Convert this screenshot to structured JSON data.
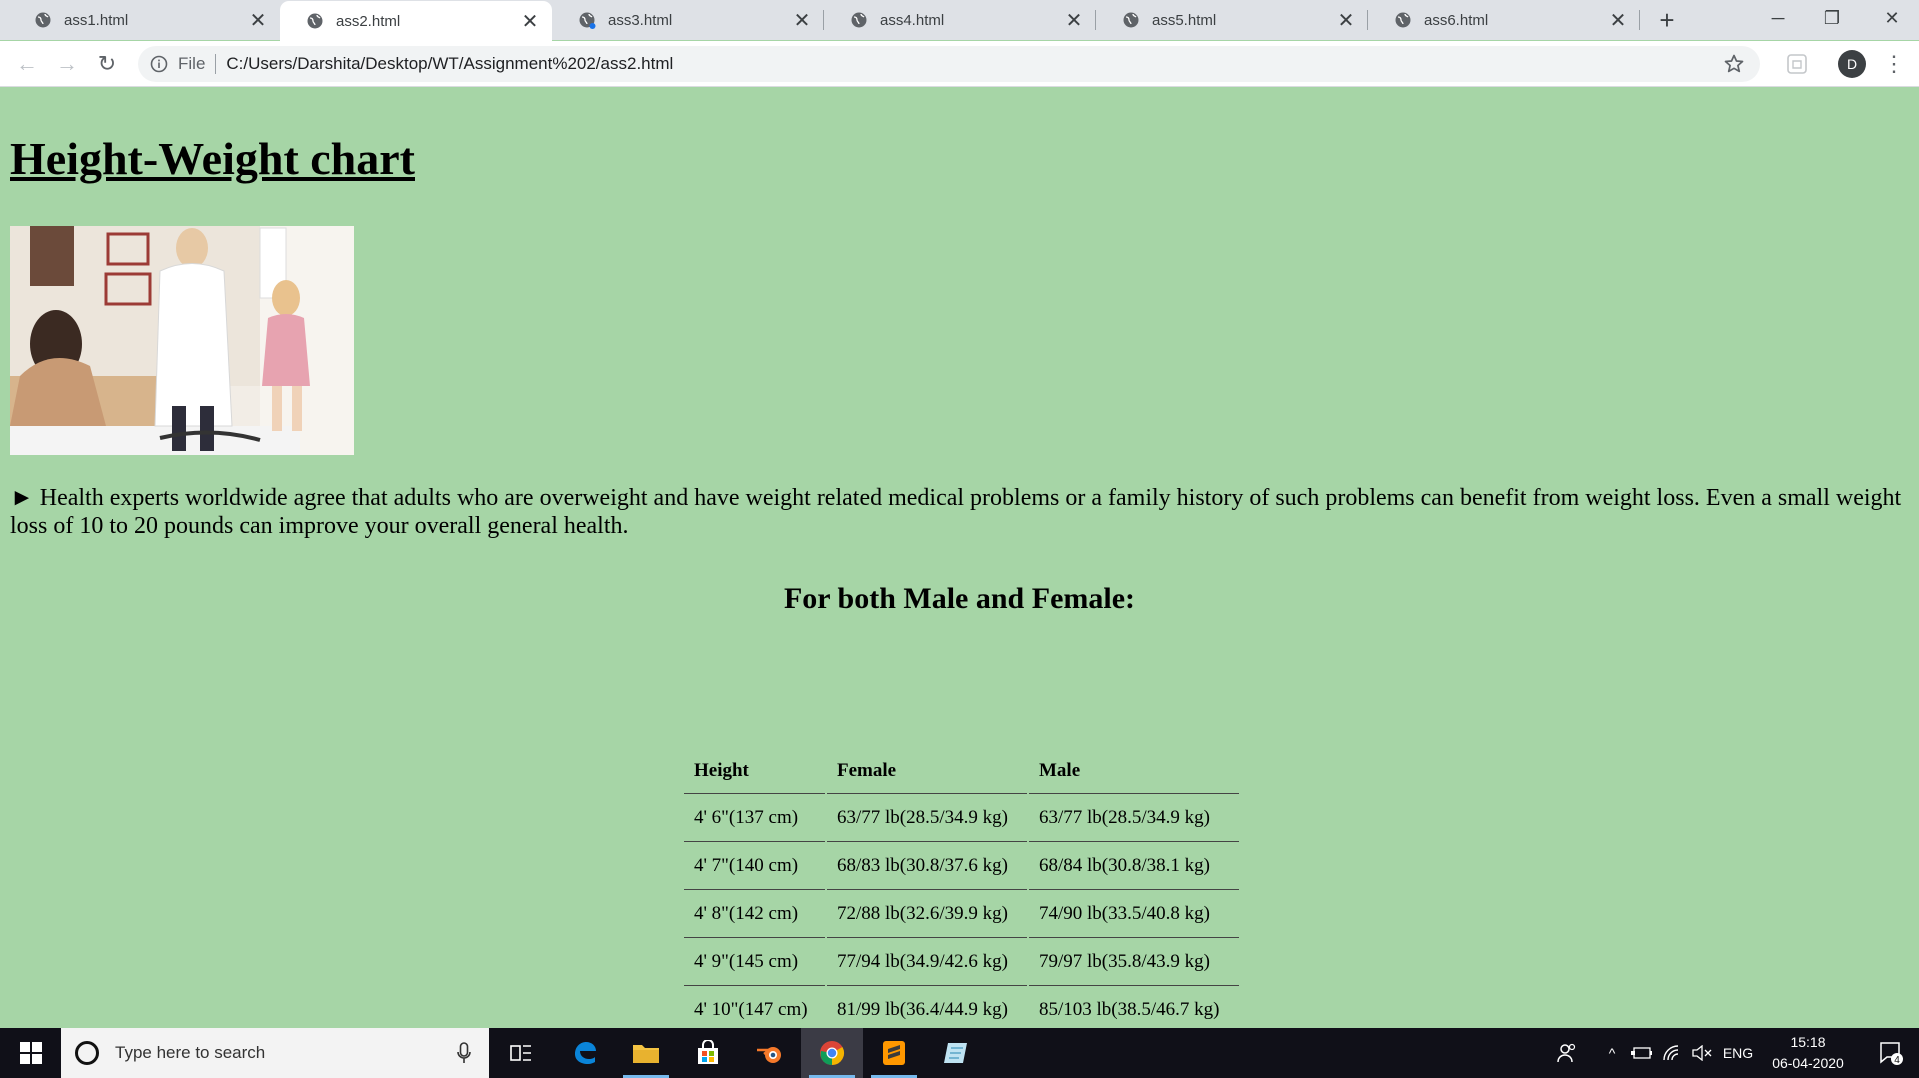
{
  "browser": {
    "tabs": [
      {
        "label": "ass1.html",
        "active": false,
        "loading": false
      },
      {
        "label": "ass2.html",
        "active": true,
        "loading": false
      },
      {
        "label": "ass3.html",
        "active": false,
        "loading": true
      },
      {
        "label": "ass4.html",
        "active": false,
        "loading": false
      },
      {
        "label": "ass5.html",
        "active": false,
        "loading": false
      },
      {
        "label": "ass6.html",
        "active": false,
        "loading": false
      }
    ],
    "close_glyph": "✕",
    "new_tab_glyph": "+",
    "window_controls": {
      "minimize": "─",
      "restore": "❐",
      "close": "✕"
    },
    "nav": {
      "back": "←",
      "forward": "→",
      "reload": "↻"
    },
    "omnibox": {
      "scheme_label": "File",
      "url": "C:/Users/Darshita/Desktop/WT/Assignment%202/ass2.html"
    },
    "profile_initial": "D",
    "menu_glyph": "⋮"
  },
  "page": {
    "title": "Height-Weight chart",
    "intro": "► Health experts worldwide agree that adults who are overweight and have weight related medical problems or a family history of such problems can benefit from weight loss. Even a small weight loss of 10 to 20 pounds can improve your overall general health.",
    "subheading": "For both Male and Female:",
    "table": {
      "headers": [
        "Height",
        "Female",
        "Male"
      ],
      "rows": [
        [
          "4' 6\"(137 cm)",
          "63/77 lb(28.5/34.9 kg)",
          "63/77 lb(28.5/34.9 kg)"
        ],
        [
          "4' 7\"(140 cm)",
          "68/83 lb(30.8/37.6 kg)",
          "68/84 lb(30.8/38.1 kg)"
        ],
        [
          "4' 8\"(142 cm)",
          "72/88 lb(32.6/39.9 kg)",
          "74/90 lb(33.5/40.8 kg)"
        ],
        [
          "4' 9\"(145 cm)",
          "77/94 lb(34.9/42.6 kg)",
          "79/97 lb(35.8/43.9 kg)"
        ],
        [
          "4' 10\"(147 cm)",
          "81/99 lb(36.4/44.9 kg)",
          "85/103 lb(38.5/46.7 kg)"
        ]
      ]
    }
  },
  "taskbar": {
    "search_placeholder": "Type here to search",
    "tray_language": "ENG",
    "tray_caret": "^",
    "time": "15:18",
    "date": "06-04-2020",
    "notification_count": "4"
  },
  "colors": {
    "page_background": "#a6d5a6",
    "tab_strip": "#dee1e6",
    "taskbar": "#101018",
    "loading_dot": "#1a73e8"
  }
}
